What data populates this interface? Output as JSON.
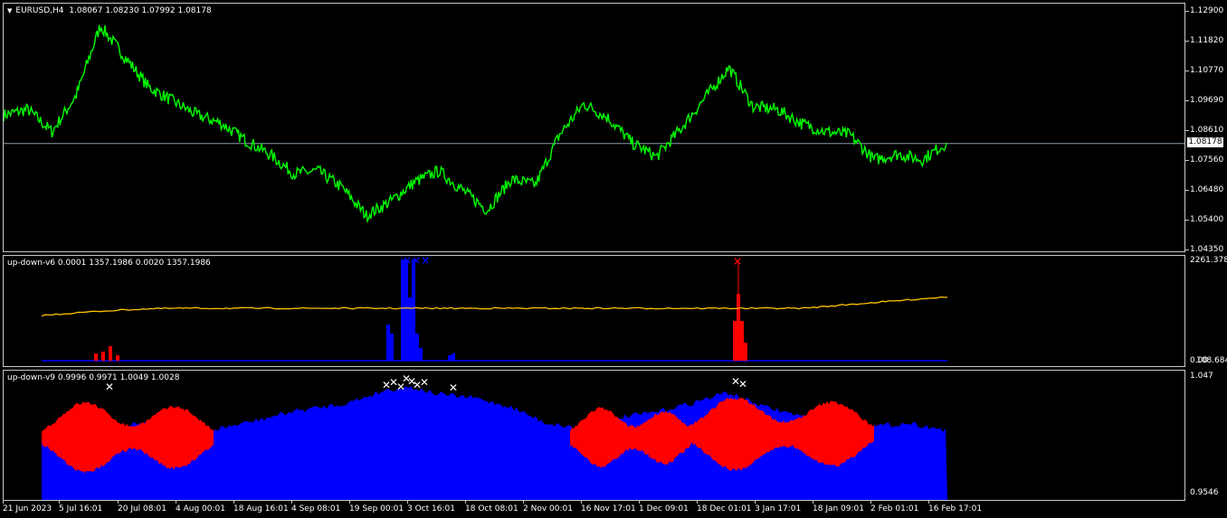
{
  "main_pane": {
    "symbol_label": "EURUSD,H4",
    "ohlc": "1.08067 1.08230 1.07992 1.08178",
    "current_price": "1.08178",
    "y_labels": [
      "1.12900",
      "1.11820",
      "1.10770",
      "1.09690",
      "1.08610",
      "1.07560",
      "1.06480",
      "1.05400",
      "1.04350"
    ],
    "line_color": "#00ff00"
  },
  "indicator_v6": {
    "label": "up-down-v6 0.0001 1357.1986 0.0020 1357.1986",
    "y_top": "2261.3787",
    "y_bottom_a": "0.00",
    "y_bottom_b": "108.6847",
    "colors": {
      "up": "#0000ff",
      "down": "#ff0000",
      "line": "#ffc000"
    }
  },
  "indicator_v9": {
    "label": "up-down-v9 0.9996 0.9971 1.0049 1.0028",
    "y_top": "1.047",
    "y_bottom": "0.9546",
    "colors": {
      "up": "#0000ff",
      "down": "#ff0000",
      "marker": "#ffffff"
    }
  },
  "x_axis": [
    "21 Jun 2023",
    "5 Jul 16:01",
    "20 Jul 08:01",
    "4 Aug 00:01",
    "18 Aug 16:01",
    "4 Sep 08:01",
    "19 Sep 00:01",
    "3 Oct 16:01",
    "18 Oct 08:01",
    "2 Nov 00:01",
    "16 Nov 17:01",
    "1 Dec 09:01",
    "18 Dec 01:01",
    "3 Jan 17:01",
    "18 Jan 09:01",
    "2 Feb 01:01",
    "16 Feb 17:01"
  ],
  "chart_data": {
    "type": "line",
    "series": [
      {
        "values": [
          1.092,
          1.094,
          1.086,
          1.099,
          1.124,
          1.113,
          1.102,
          1.097,
          1.092,
          1.089,
          1.083,
          1.078,
          1.071,
          1.072,
          1.066,
          1.056,
          1.061,
          1.068,
          1.072,
          1.065,
          1.058,
          1.069,
          1.067,
          1.085,
          1.096,
          1.091,
          1.082,
          1.077,
          1.087,
          1.098,
          1.109,
          1.095,
          1.094,
          1.089,
          1.086,
          1.085,
          1.076,
          1.078,
          1.076,
          1.082
        ]
      }
    ],
    "ylim": [
      1.0435,
      1.129
    ]
  }
}
